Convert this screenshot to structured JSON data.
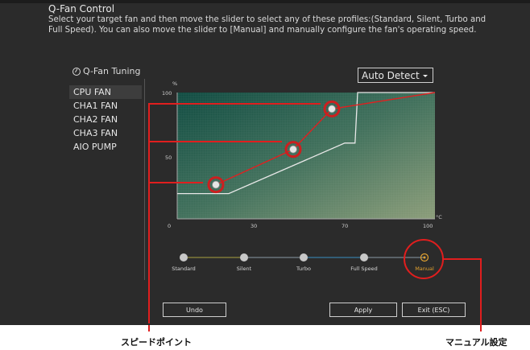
{
  "header": {
    "title": "Q-Fan Control",
    "description": "Select your target fan and then move the slider to select any of these profiles:(Standard, Silent, Turbo and Full Speed). You can also move the slider to [Manual] and manually configure the fan's operating speed."
  },
  "fan_panel": {
    "title": "Q-Fan Tuning",
    "fans": [
      "CPU FAN",
      "CHA1 FAN",
      "CHA2 FAN",
      "CHA3 FAN",
      "AIO PUMP"
    ],
    "selected": "CPU FAN"
  },
  "dropdown": {
    "value": "Auto Detect"
  },
  "chart": {
    "y_unit": "%",
    "x_unit": "°C",
    "y_ticks": [
      "100",
      "50",
      "0"
    ],
    "x_ticks": [
      "30",
      "70",
      "100"
    ]
  },
  "chart_data": {
    "type": "line",
    "title": "",
    "xlabel": "°C",
    "ylabel": "%",
    "xlim": [
      0,
      100
    ],
    "ylim": [
      0,
      100
    ],
    "series": [
      {
        "x": [
          0,
          20,
          65,
          69,
          70,
          100
        ],
        "y": [
          20,
          20,
          60,
          60,
          100,
          100
        ]
      },
      {
        "x": [
          15,
          45,
          60,
          100
        ],
        "y": [
          27,
          55,
          87,
          100
        ]
      }
    ],
    "speed_points": [
      {
        "temp": 15,
        "speed": 27
      },
      {
        "temp": 45,
        "speed": 55
      },
      {
        "temp": 60,
        "speed": 87
      }
    ],
    "colors": {
      "preset": "#e8e8e8",
      "manual": "#e02020",
      "markers": "#cc1f1f"
    }
  },
  "profiles": [
    "Standard",
    "Silent",
    "Turbo",
    "Full Speed",
    "Manual"
  ],
  "selected_profile": "Manual",
  "buttons": {
    "undo": "Undo",
    "apply": "Apply",
    "exit": "Exit (ESC)"
  },
  "callouts": {
    "speed_point": "スピードポイント",
    "manual": "マニュアル設定"
  },
  "colors": {
    "highlight": "#e01e1e",
    "manual_profile": "#e0a030"
  }
}
